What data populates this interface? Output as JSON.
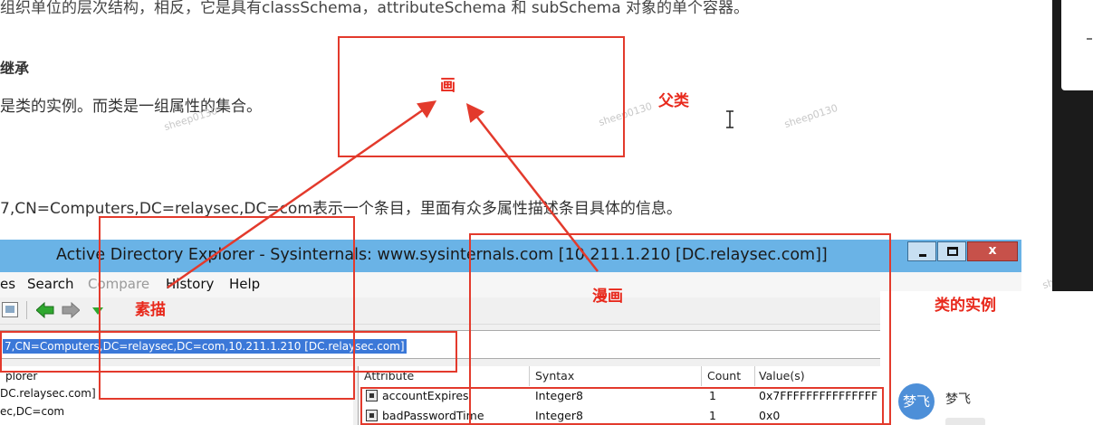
{
  "document": {
    "line1": "组织单位的层次结构，相反，它是具有classSchema，attributeSchema 和 subSchema 对象的单个容器。",
    "heading": "继承",
    "line2": "是类的实例。而类是一组属性的集合。",
    "line3": "7,CN=Computers,DC=relaysec,DC=com表示一个条目，里面有众多属性描述条目具体的信息。",
    "watermark": "sheep0130"
  },
  "annotations": {
    "hua": "画",
    "fulei": "父类",
    "sumiao": "素描",
    "manhua": "漫画",
    "lei_shili": "类的实例",
    "color": "#e8291c"
  },
  "window": {
    "title": "Active Directory Explorer - Sysinternals: www.sysinternals.com [10.211.1.210 [DC.relaysec.com]]",
    "close_label": "x",
    "titlebar_color": "#6ab3e6",
    "menu": {
      "file": "es",
      "search": "Search",
      "compare": "Compare",
      "history": "History",
      "help": "Help"
    },
    "toolbar": {
      "icons": [
        "properties-icon",
        "back-arrow-icon",
        "forward-arrow-icon",
        "dropdown-arrow-icon"
      ]
    },
    "address": "7,CN=Computers,DC=relaysec,DC=com,10.211.1.210 [DC.relaysec.com]",
    "tree": {
      "item1": "plorer",
      "item2": "DC.relaysec.com]",
      "item3": "ec,DC=com"
    },
    "columns": {
      "attribute": "Attribute",
      "syntax": "Syntax",
      "count": "Count",
      "values": "Value(s)"
    },
    "rows": [
      {
        "attribute": "accountExpires",
        "syntax": "Integer8",
        "count": "1",
        "value": "0x7FFFFFFFFFFFFFFF"
      },
      {
        "attribute": "badPasswordTime",
        "syntax": "Integer8",
        "count": "1",
        "value": "0x0"
      }
    ]
  },
  "chat": {
    "avatar_text": "梦飞",
    "name": "梦飞",
    "avatar_color": "#4d8fd8"
  }
}
